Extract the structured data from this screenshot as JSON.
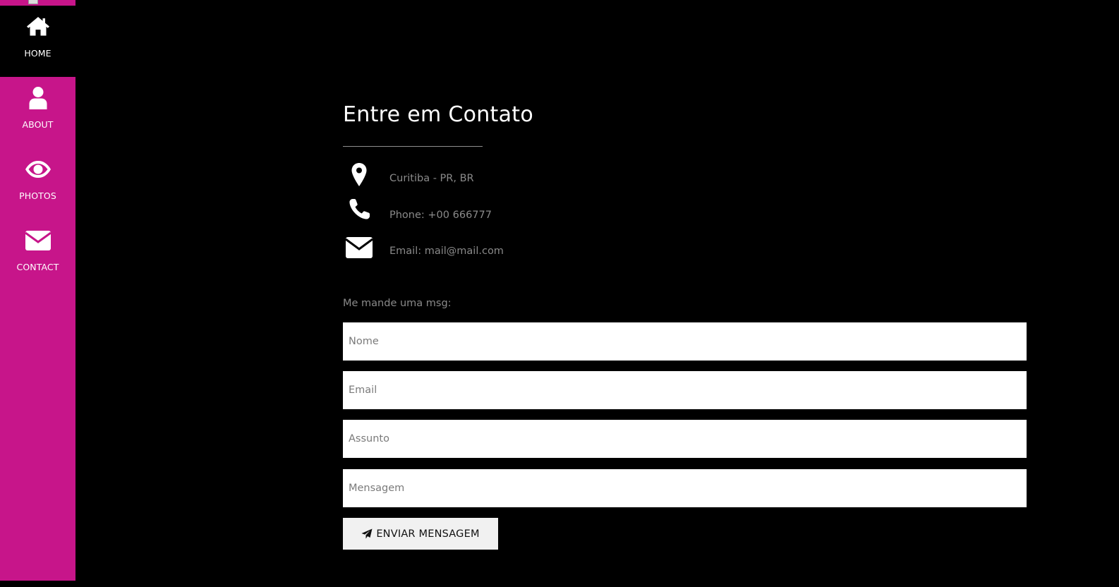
{
  "colors": {
    "sidebar_bg": "#c7158a",
    "active_bg": "#000000",
    "page_bg": "#000000",
    "muted_text": "#8a8a8a"
  },
  "sidebar": {
    "items": [
      {
        "label": "HOME",
        "icon": "home-icon",
        "active": true
      },
      {
        "label": "ABOUT",
        "icon": "user-icon",
        "active": false
      },
      {
        "label": "PHOTOS",
        "icon": "eye-icon",
        "active": false
      },
      {
        "label": "CONTACT",
        "icon": "envelope-icon",
        "active": false
      }
    ]
  },
  "contact": {
    "title": "Entre em Contato",
    "info": [
      {
        "icon": "map-marker-icon",
        "text": "Curitiba - PR, BR"
      },
      {
        "icon": "phone-icon",
        "text": "Phone: +00 666777"
      },
      {
        "icon": "envelope-icon",
        "text": "Email: mail@mail.com"
      }
    ],
    "form_label": "Me mande uma msg:",
    "fields": {
      "name_placeholder": "Nome",
      "email_placeholder": "Email",
      "subject_placeholder": "Assunto",
      "message_placeholder": "Mensagem"
    },
    "submit_label": "ENVIAR MENSAGEM"
  }
}
